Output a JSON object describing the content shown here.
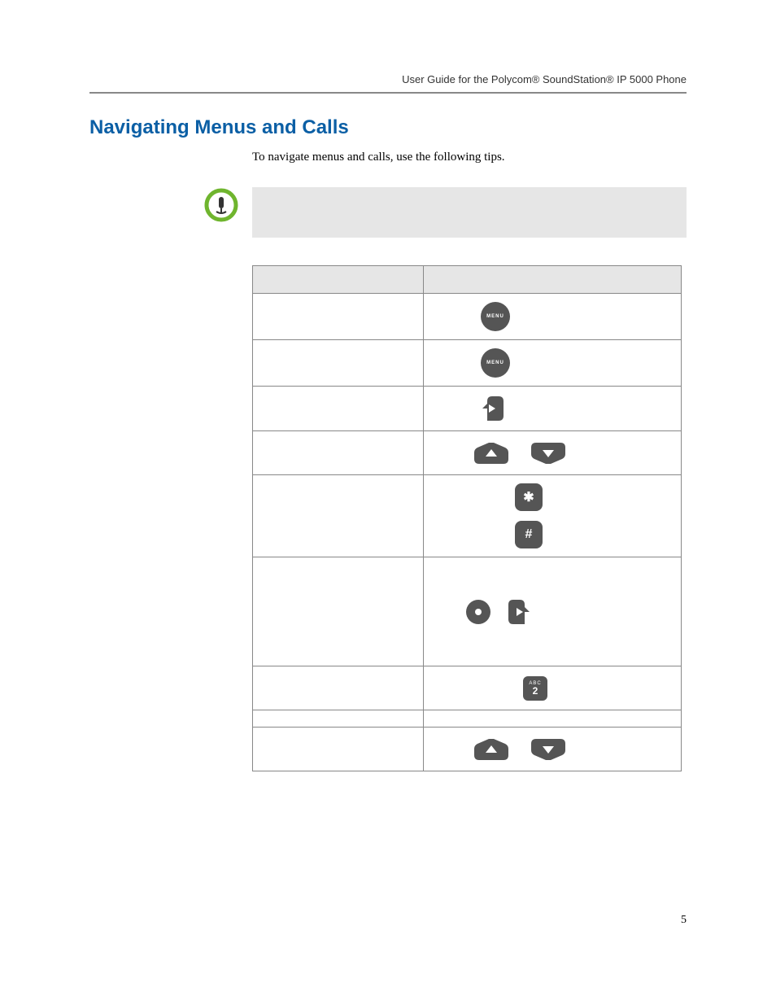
{
  "header": {
    "text": "User Guide for the Polycom® SoundStation® IP 5000 Phone"
  },
  "section": {
    "title": "Navigating Menus and Calls"
  },
  "intro": {
    "text": "To navigate menus and calls, use the following tips."
  },
  "table": {
    "headers": [
      "",
      ""
    ],
    "rows": [
      {
        "left": "",
        "right_icons": [
          "menu"
        ]
      },
      {
        "left": "",
        "right_icons": [
          "menu"
        ]
      },
      {
        "left": "",
        "right_icons": [
          "arrow-left"
        ]
      },
      {
        "left": "",
        "right_icons": [
          "arrow-up",
          "arrow-down"
        ]
      },
      {
        "left": "",
        "right_icons": [
          "star",
          "hash"
        ]
      },
      {
        "left": "",
        "right_icons": [
          "select",
          "arrow-right"
        ]
      },
      {
        "left": "",
        "right_icons": [
          "dialkey-2"
        ]
      },
      {
        "left": "",
        "right_icons": []
      },
      {
        "left": "",
        "right_icons": [
          "arrow-up",
          "arrow-down"
        ]
      }
    ]
  },
  "icons": {
    "menu_label": "MENU",
    "dialkey2_abc": "ABC",
    "dialkey2_num": "2",
    "star": "✱",
    "hash": "#"
  },
  "page_number": "5"
}
